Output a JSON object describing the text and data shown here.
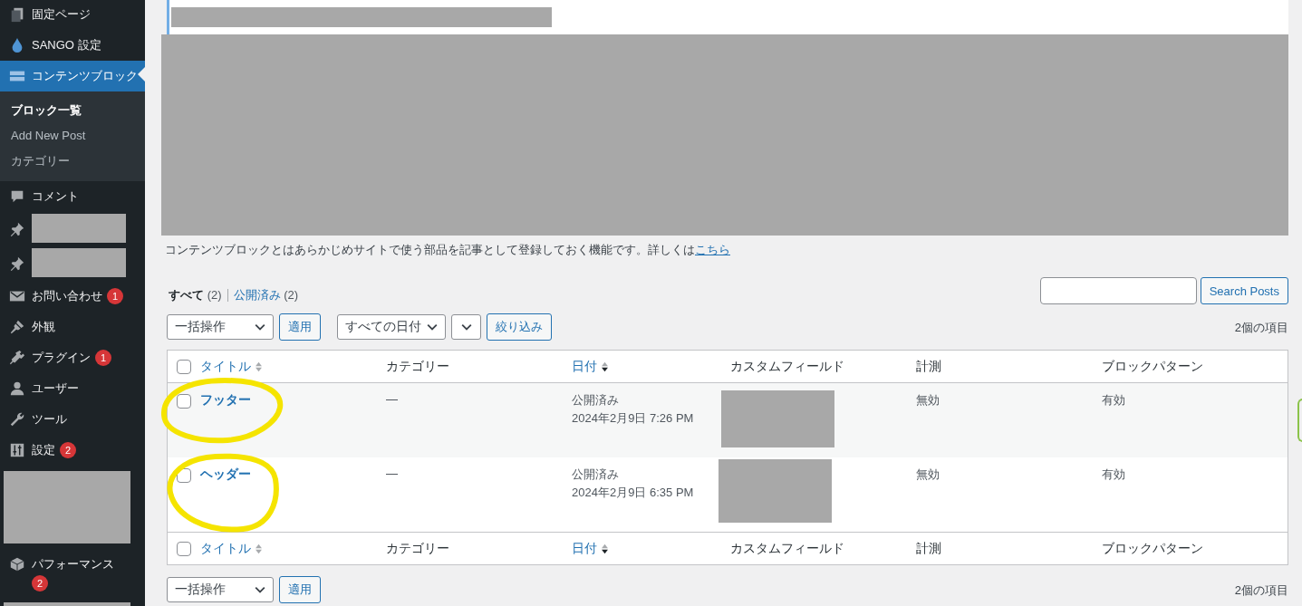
{
  "sidebar": {
    "items": [
      {
        "kind": "item",
        "label": "固定ページ",
        "selected": false
      },
      {
        "kind": "item",
        "label": "SANGO 設定",
        "selected": false
      },
      {
        "kind": "item",
        "label": "コンテンツブロック",
        "selected": true,
        "children": [
          {
            "label": "ブロック一覧",
            "selected": true
          },
          {
            "label": "Add New Post",
            "selected": false
          },
          {
            "label": "カテゴリー",
            "selected": false
          }
        ]
      },
      {
        "kind": "item",
        "label": "コメント",
        "selected": false
      },
      {
        "kind": "redacted-pin"
      },
      {
        "kind": "redacted-pin"
      },
      {
        "kind": "item",
        "label": "お問い合わせ",
        "badge": "1",
        "badge_below": false,
        "selected": false
      },
      {
        "kind": "item",
        "label": "外観",
        "selected": false
      },
      {
        "kind": "item",
        "label": "プラグイン",
        "badge": "1",
        "badge_below": false,
        "selected": false
      },
      {
        "kind": "item",
        "label": "ユーザー",
        "selected": false
      },
      {
        "kind": "item",
        "label": "ツール",
        "selected": false
      },
      {
        "kind": "item",
        "label": "設定",
        "badge": "2",
        "badge_below": false,
        "selected": false
      },
      {
        "kind": "redacted"
      },
      {
        "kind": "item",
        "label": "パフォーマンス",
        "badge": "2",
        "badge_below": true,
        "selected": false
      },
      {
        "kind": "redacted"
      }
    ]
  },
  "description": {
    "text": "コンテンツブロックとはあらかじめサイトで使う部品を記事として登録しておく機能です。詳しくは",
    "link": "こちら"
  },
  "views": [
    {
      "label": "すべて",
      "count": "(2)",
      "selected": true
    },
    {
      "label": "公開済み",
      "count": "(2)",
      "selected": false
    }
  ],
  "search": {
    "button": "Search Posts"
  },
  "top_toolbar": {
    "bulk_action": "一括操作",
    "apply": "適用",
    "date_filter": "すべての日付",
    "filter_button": "絞り込み",
    "item_count": "2個の項目"
  },
  "table": {
    "select_all_checked": false,
    "columns": [
      {
        "label": "タイトル",
        "sortable": true,
        "sorted": false
      },
      {
        "label": "カテゴリー",
        "sortable": false
      },
      {
        "label": "日付",
        "sortable": true,
        "sorted": true
      },
      {
        "label": "カスタムフィールド",
        "sortable": false
      },
      {
        "label": "計測",
        "sortable": false
      },
      {
        "label": "ブロックパターン",
        "sortable": false
      }
    ],
    "footer_select_all_checked": false,
    "footer_columns": [
      {
        "label": "タイトル",
        "sortable": true,
        "sorted": false
      },
      {
        "label": "カテゴリー",
        "sortable": false
      },
      {
        "label": "日付",
        "sortable": true,
        "sorted": true
      },
      {
        "label": "カスタムフィールド",
        "sortable": false
      },
      {
        "label": "計測",
        "sortable": false
      },
      {
        "label": "ブロックパターン",
        "sortable": false
      }
    ],
    "rows": [
      {
        "title": "フッター",
        "category": "—",
        "status": "公開済み",
        "date": "2024年2月9日 7:26 PM",
        "measure": "無効",
        "pattern": "有効",
        "checked": false
      },
      {
        "title": "ヘッダー",
        "category": "—",
        "status": "公開済み",
        "date": "2024年2月9日 6:35 PM",
        "measure": "無効",
        "pattern": "有効",
        "checked": false
      }
    ]
  },
  "bottom_toolbar": {
    "bulk_action": "一括操作",
    "apply": "適用",
    "item_count": "2個の項目"
  }
}
